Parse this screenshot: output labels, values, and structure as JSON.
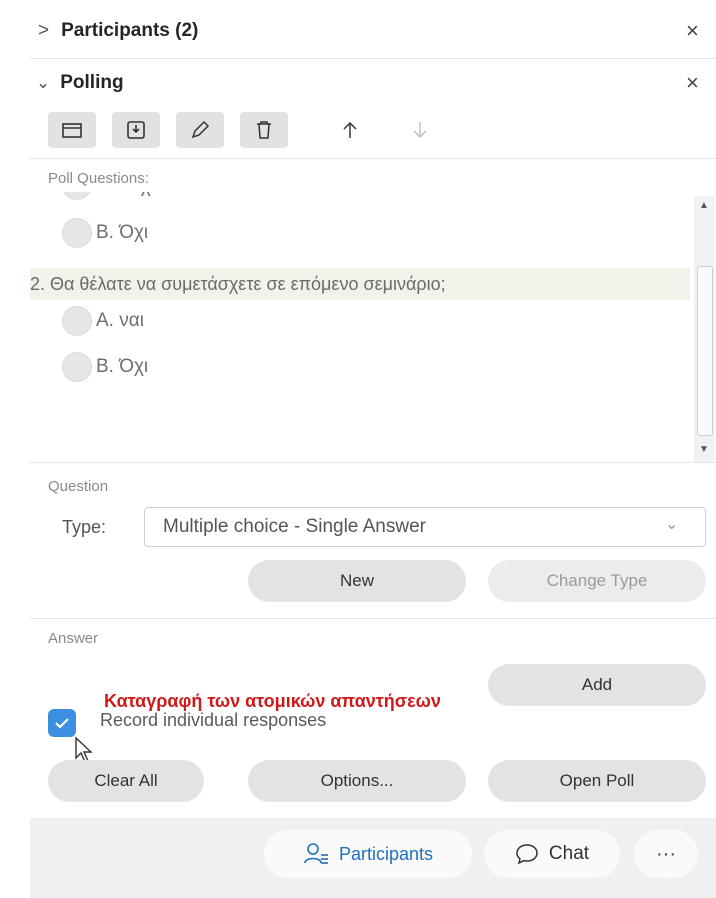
{
  "participants_section": {
    "chevron": ">",
    "title": "Participants (2)",
    "close": "×"
  },
  "polling_section": {
    "chevron": "⌄",
    "title": "Polling",
    "close": "×",
    "toolbar": [
      "folder-icon",
      "save-icon",
      "edit-icon",
      "delete-icon",
      "move-up-icon",
      "move-down-icon"
    ]
  },
  "poll_questions": {
    "label": "Poll Questions:",
    "clipped_text": "Όχ",
    "prev_option": "B. Όχι",
    "question2": {
      "text": "2.  Θα θέλατε να συμετάσχετε σε επόμενο σεμινάριο;",
      "options": [
        "A.  ναι",
        "B.  Όχι"
      ]
    }
  },
  "question": {
    "label": "Question",
    "type_label": "Type:",
    "type_value": "Multiple choice - Single Answer",
    "new_button": "New",
    "change_type_button": "Change Type"
  },
  "answer": {
    "label": "Answer",
    "add_button": "Add",
    "annotation": "Καταγραφή των ατομικών απαντήσεων",
    "record_label": "Record individual responses",
    "record_checked": true
  },
  "actions": {
    "clear_all": "Clear All",
    "options": "Options...",
    "open_poll": "Open Poll"
  },
  "bottom_bar": {
    "participants": "Participants",
    "chat": "Chat",
    "more": "···"
  },
  "colors": {
    "accent": "#1f6fbf",
    "checkbox": "#3b8ee0",
    "annotation": "#d01a1a"
  }
}
